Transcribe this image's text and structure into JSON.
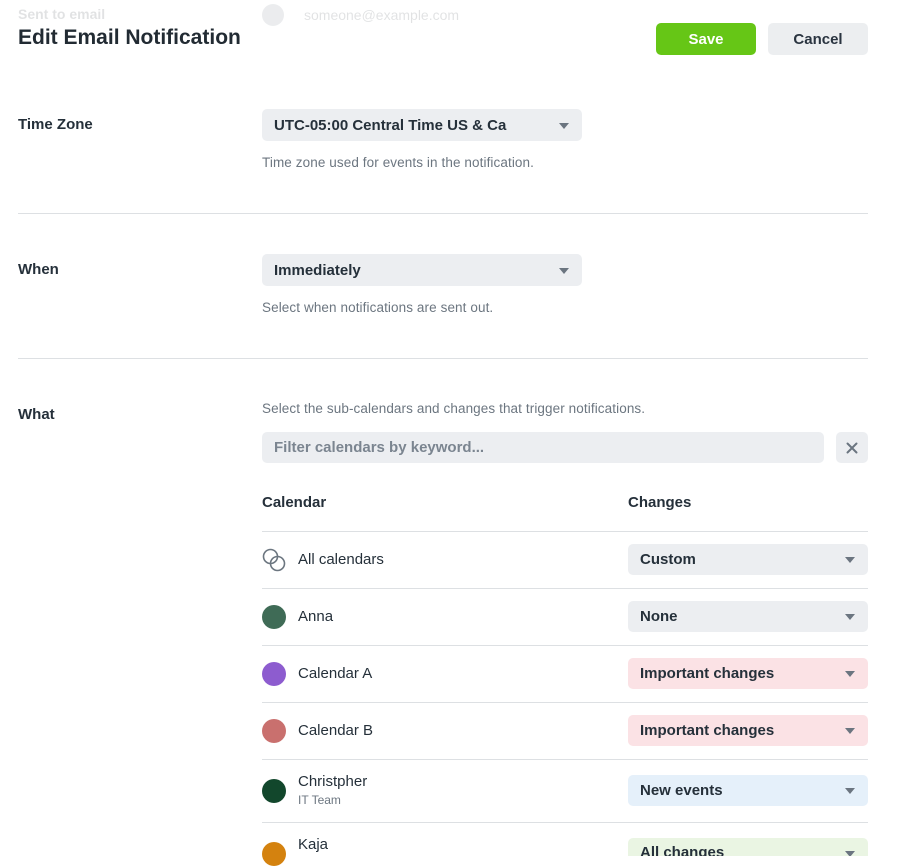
{
  "ghost": {
    "label": "Sent to email",
    "value": "someone@example.com"
  },
  "header": {
    "title": "Edit Email Notification",
    "save_label": "Save",
    "cancel_label": "Cancel"
  },
  "timezone": {
    "label": "Time Zone",
    "value": "UTC-05:00 Central Time US & Ca",
    "help": "Time zone used for events in the notification."
  },
  "when": {
    "label": "When",
    "value": "Immediately",
    "help": "Select when notifications are sent out."
  },
  "what": {
    "label": "What",
    "help": "Select the sub-calendars and changes that trigger notifications.",
    "filter_placeholder": "Filter calendars by keyword...",
    "col_calendar": "Calendar",
    "col_changes": "Changes",
    "rows": [
      {
        "name": "All calendars",
        "sub": "",
        "change": "Custom",
        "color": "",
        "change_bg": "#eceef1",
        "icon": "all-calendars-icon"
      },
      {
        "name": "Anna",
        "sub": "",
        "change": "None",
        "color": "#3f6b56",
        "change_bg": "#eceef1"
      },
      {
        "name": "Calendar A",
        "sub": "",
        "change": "Important changes",
        "color": "#8d5ccf",
        "change_bg": "#fbe2e5"
      },
      {
        "name": "Calendar B",
        "sub": "",
        "change": "Important changes",
        "color": "#c9706e",
        "change_bg": "#fbe2e5"
      },
      {
        "name": "Christpher",
        "sub": "IT Team",
        "change": "New events",
        "color": "#12472c",
        "change_bg": "#e5f0fa"
      },
      {
        "name": "Kaja",
        "sub": "",
        "change": "All changes",
        "color": "#d4820f",
        "change_bg": "#eaf5e3"
      }
    ]
  }
}
